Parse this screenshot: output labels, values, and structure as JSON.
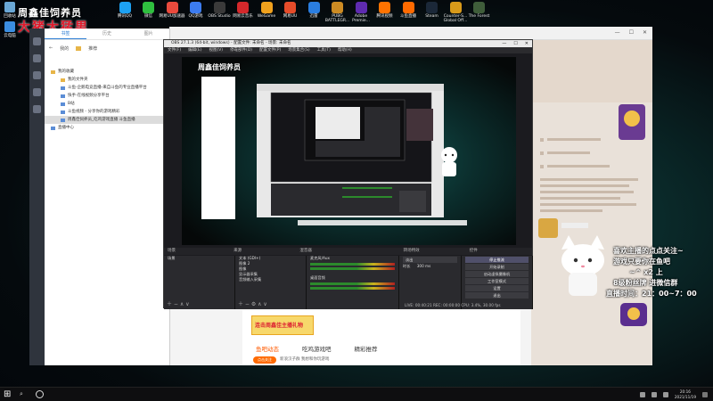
{
  "overlay": {
    "line1": "周鑫佳饲养员",
    "line2": "大猪大猛男"
  },
  "desktop_icons_left": [
    "回收站",
    "云电脑"
  ],
  "desktop_icons_top": [
    {
      "label": "腾讯QQ",
      "color": "#1da1f2"
    },
    {
      "label": "微信",
      "color": "#2fbf3f"
    },
    {
      "label": "网易UU加速器",
      "color": "#e94a3d"
    },
    {
      "label": "QQ游戏",
      "color": "#3c7cf0"
    },
    {
      "label": "OBS Studio",
      "color": "#3a3a3a"
    },
    {
      "label": "网易云音乐",
      "color": "#d4282b"
    },
    {
      "label": "WeGame",
      "color": "#f0a11d"
    },
    {
      "label": "网易UU",
      "color": "#e64c2a"
    },
    {
      "label": "迅雷",
      "color": "#2a7ee0"
    },
    {
      "label": "PUBG BATTLEGR...",
      "color": "#cc8b23"
    },
    {
      "label": "Adobe Premie...",
      "color": "#5e2bb0"
    },
    {
      "label": "腾讯视频",
      "color": "#ff7300"
    },
    {
      "label": "斗鱼直播",
      "color": "#ff6a00"
    },
    {
      "label": "Steam",
      "color": "#1b2838"
    },
    {
      "label": "Counter-S... Global Off...",
      "color": "#d89a1a"
    },
    {
      "label": "The Forest",
      "color": "#3f5d3a"
    }
  ],
  "file_manager": {
    "tabs": [
      "书签",
      "历史",
      "图片"
    ],
    "toolbar": [
      "我的",
      "推荐"
    ],
    "tree": [
      {
        "label": "我的收藏",
        "level": 0,
        "type": "folder",
        "selected": false
      },
      {
        "label": "我的文件夹",
        "level": 1,
        "type": "folder",
        "selected": false
      },
      {
        "label": "斗鱼-企鹅电竞直播-来自斗鱼的专业直播平台",
        "level": 1,
        "type": "doc",
        "selected": false
      },
      {
        "label": "快手-在线视频分享平台",
        "level": 1,
        "type": "doc",
        "selected": false
      },
      {
        "label": "B站",
        "level": 1,
        "type": "doc",
        "selected": false
      },
      {
        "label": "斗鱼视频 - 分享你的游戏精彩",
        "level": 1,
        "type": "doc",
        "selected": false
      },
      {
        "label": "周鑫佳饲养员_吃鸡游戏直播 斗鱼直播",
        "level": 1,
        "type": "doc",
        "selected": true
      },
      {
        "label": "直播中心",
        "level": 0,
        "type": "doc",
        "selected": false
      }
    ]
  },
  "obs": {
    "title": "OBS 27.1.3 (64-bit, windows) - 配置文件: 未命名 - 场景: 未命名",
    "menu": [
      "文件(F)",
      "编辑(E)",
      "视图(V)",
      "停靠部件(D)",
      "配置文件(P)",
      "场景集合(S)",
      "工具(T)",
      "帮助(H)"
    ],
    "docks": [
      "场景",
      "来源",
      "混音器",
      "转场特效",
      "控件"
    ],
    "scenes": [
      "场景"
    ],
    "sources": [
      "文本 (GDI+)",
      "图像 2",
      "图像",
      "显示器采集",
      "音频输入采集"
    ],
    "mixer": [
      {
        "name": "麦克风/Aux",
        "level": 0.55
      },
      {
        "name": "桌面音频",
        "level": 0.4
      }
    ],
    "transition": {
      "label": "淡出",
      "duration_label": "时长",
      "duration": "300 ms"
    },
    "controls": [
      "停止推流",
      "开始录制",
      "启动虚拟摄像机",
      "工作室模式",
      "设置",
      "退出"
    ],
    "status": "LIVE: 00:40:21   REC: 00:00:00   CPU: 3.4%, 30.00 fps"
  },
  "browser": {
    "tabs_row": [
      "鱼吧动态",
      "吃鸡游戏吧",
      "精彩推荐"
    ],
    "active_tab_index": 0,
    "ad_text": "连击周鑫佳主播礼物",
    "pill": "点击关注",
    "footer": "新浪汉子群 我想和你玩游戏"
  },
  "streamer_panel": {
    "lines": [
      "喜欢主播的点点关注~",
      "游戏只要你在鱼吧",
      "~^ x2 上",
      "8级粉丝牌 进微信群",
      "直播时间：21：00~7：00"
    ]
  },
  "taskbar": {
    "time": "20:16",
    "date": "2021/11/19"
  }
}
